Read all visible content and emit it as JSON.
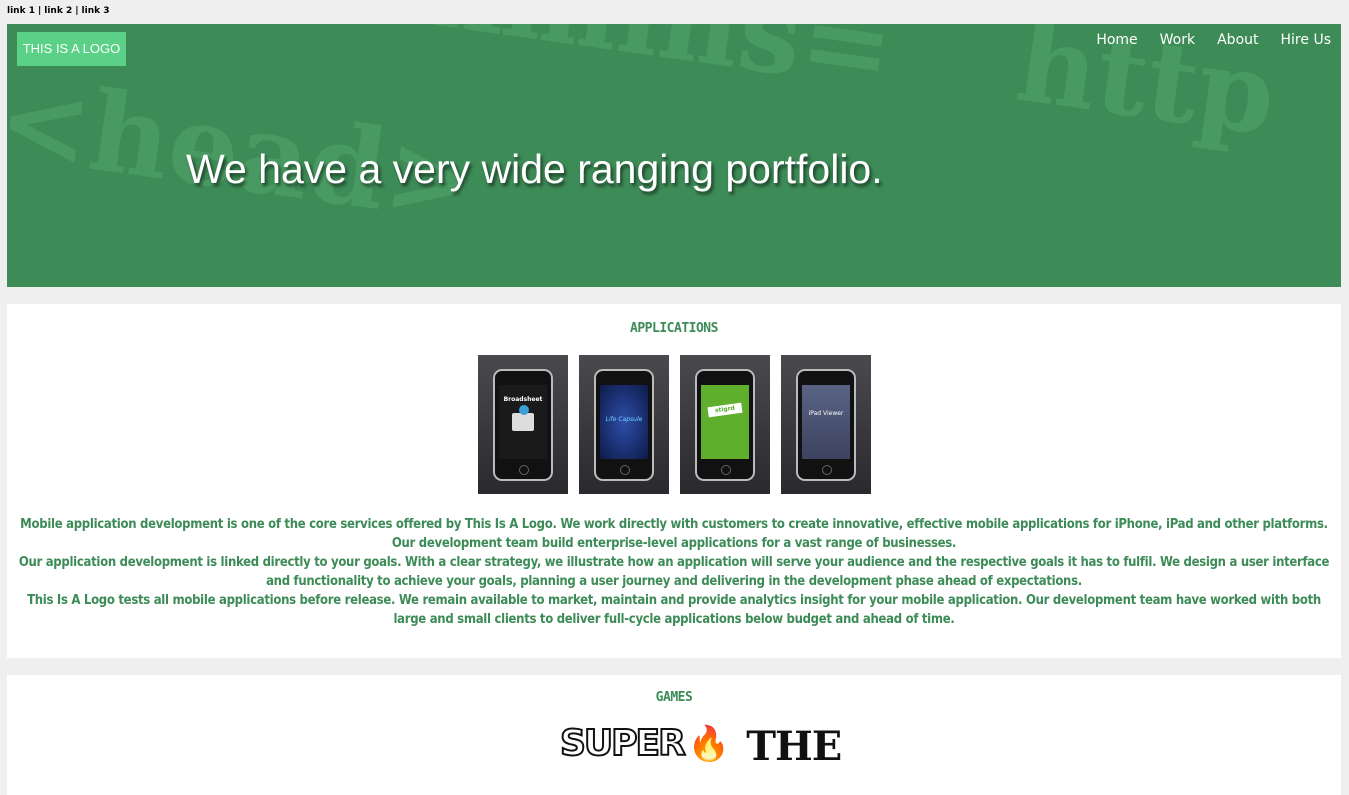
{
  "top_links": [
    "link 1",
    "link 2",
    "link 3"
  ],
  "top_links_separator": "|",
  "hero": {
    "logo": "THIS IS A LOGO",
    "nav": [
      "Home",
      "Work",
      "About",
      "Hire Us"
    ],
    "headline": "We have a very wide ranging portfolio.",
    "background_text": [
      "<head>",
      "xmlns=",
      "http"
    ]
  },
  "applications": {
    "title": "APPLICATIONS",
    "phones": [
      {
        "label": "Broadsheet",
        "screen_color": "#1a1a1a"
      },
      {
        "label": "Life Capsule",
        "screen_color": "#1b2f77"
      },
      {
        "label": "stigrd",
        "screen_color": "#5fae2c"
      },
      {
        "label": "iPad Viewer",
        "screen_color": "#4a5270"
      }
    ],
    "description": [
      "Mobile application development is one of the core services offered by This Is A Logo. We work directly with customers to create innovative, effective mobile applications for iPhone, iPad and other platforms. Our development team build enterprise-level applications for a vast range of businesses.",
      "Our application development is linked directly to your goals. With a clear strategy, we illustrate how an application will serve your audience and the respective goals it has to fulfil. We design a user interface and functionality to achieve your goals, planning a user journey and delivering in the development phase ahead of expectations.",
      "This Is A Logo tests all mobile applications before release. We remain available to market, maintain and provide analytics insight for your mobile application. Our development team have worked with both large and small clients to deliver full-cycle applications below budget and ahead of time."
    ]
  },
  "games": {
    "title": "GAMES",
    "logos": [
      "SUPER",
      "THE"
    ]
  },
  "colors": {
    "brand_green": "#3d8b57",
    "logo_green": "#5bd187",
    "page_bg": "#efefef"
  }
}
